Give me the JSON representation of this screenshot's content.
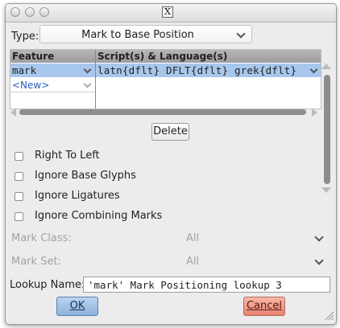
{
  "window": {
    "title_icon": "x11-icon"
  },
  "type": {
    "label": "Type:",
    "value": "Mark to Base Position"
  },
  "table": {
    "columns": [
      "Feature",
      "Script(s) & Language(s)"
    ],
    "rows": [
      {
        "feature": "mark",
        "scripts": "latn{dflt} DFLT{dflt} grek{dflt}"
      }
    ],
    "new_label": "<New>"
  },
  "delete_label": "Delete",
  "checkboxes": [
    {
      "label": "Right To Left",
      "checked": false
    },
    {
      "label": "Ignore Base Glyphs",
      "checked": false
    },
    {
      "label": "Ignore Ligatures",
      "checked": false
    },
    {
      "label": "Ignore Combining Marks",
      "checked": false
    }
  ],
  "mark_class": {
    "label": "Mark Class:",
    "value": "All"
  },
  "mark_set": {
    "label": "Mark Set:",
    "value": "All"
  },
  "lookup_name": {
    "label": "Lookup Name:",
    "value": "'mark' Mark Positioning lookup 3"
  },
  "buttons": {
    "ok": "OK",
    "cancel": "Cancel"
  },
  "colors": {
    "selection": "#a8c7ec",
    "ok_bg": "#9fc1e6",
    "cancel_bg": "#f29a86",
    "link": "#2a5bbf"
  }
}
